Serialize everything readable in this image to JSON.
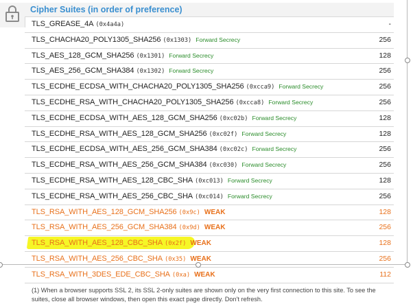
{
  "panel": {
    "title": "Cipher Suites (in order of preference)"
  },
  "suites": [
    {
      "name": "TLS_GREASE_4A",
      "hex": "(0x4a4a)",
      "tag": "",
      "bits": "-"
    },
    {
      "name": "TLS_CHACHA20_POLY1305_SHA256",
      "hex": "(0x1303)",
      "tag": "Forward Secrecy",
      "bits": "256"
    },
    {
      "name": "TLS_AES_128_GCM_SHA256",
      "hex": "(0x1301)",
      "tag": "Forward Secrecy",
      "bits": "128"
    },
    {
      "name": "TLS_AES_256_GCM_SHA384",
      "hex": "(0x1302)",
      "tag": "Forward Secrecy",
      "bits": "256"
    },
    {
      "name": "TLS_ECDHE_ECDSA_WITH_CHACHA20_POLY1305_SHA256",
      "hex": "(0xcca9)",
      "tag": "Forward Secrecy",
      "bits": "256"
    },
    {
      "name": "TLS_ECDHE_RSA_WITH_CHACHA20_POLY1305_SHA256",
      "hex": "(0xcca8)",
      "tag": "Forward Secrecy",
      "bits": "256"
    },
    {
      "name": "TLS_ECDHE_ECDSA_WITH_AES_128_GCM_SHA256",
      "hex": "(0xc02b)",
      "tag": "Forward Secrecy",
      "bits": "128"
    },
    {
      "name": "TLS_ECDHE_RSA_WITH_AES_128_GCM_SHA256",
      "hex": "(0xc02f)",
      "tag": "Forward Secrecy",
      "bits": "128"
    },
    {
      "name": "TLS_ECDHE_ECDSA_WITH_AES_256_GCM_SHA384",
      "hex": "(0xc02c)",
      "tag": "Forward Secrecy",
      "bits": "256"
    },
    {
      "name": "TLS_ECDHE_RSA_WITH_AES_256_GCM_SHA384",
      "hex": "(0xc030)",
      "tag": "Forward Secrecy",
      "bits": "256"
    },
    {
      "name": "TLS_ECDHE_RSA_WITH_AES_128_CBC_SHA",
      "hex": "(0xc013)",
      "tag": "Forward Secrecy",
      "bits": "128"
    },
    {
      "name": "TLS_ECDHE_RSA_WITH_AES_256_CBC_SHA",
      "hex": "(0xc014)",
      "tag": "Forward Secrecy",
      "bits": "256"
    },
    {
      "name": "TLS_RSA_WITH_AES_128_GCM_SHA256",
      "hex": "(0x9c)",
      "tag": "WEAK",
      "bits": "128"
    },
    {
      "name": "TLS_RSA_WITH_AES_256_GCM_SHA384",
      "hex": "(0x9d)",
      "tag": "WEAK",
      "bits": "256"
    },
    {
      "name": "TLS_RSA_WITH_AES_128_CBC_SHA",
      "hex": "(0x2f)",
      "tag": "WEAK",
      "bits": "128"
    },
    {
      "name": "TLS_RSA_WITH_AES_256_CBC_SHA",
      "hex": "(0x35)",
      "tag": "WEAK",
      "bits": "256"
    },
    {
      "name": "TLS_RSA_WITH_3DES_EDE_CBC_SHA",
      "hex": "(0xa)",
      "tag": "WEAK",
      "bits": "112"
    }
  ],
  "footnote": "(1) When a browser supports SSL 2, its SSL 2-only suites are shown only on the very first connection to this site. To see the suites, close all browser windows, then open this exact page directly. Don't refresh.",
  "colors": {
    "title": "#3a8fd0",
    "forward_secrecy": "#2a8c2a",
    "weak": "#e8701a",
    "highlight": "#f5f500"
  },
  "icons": {
    "lock": "lock-icon"
  },
  "highlighted_row_index": 14
}
